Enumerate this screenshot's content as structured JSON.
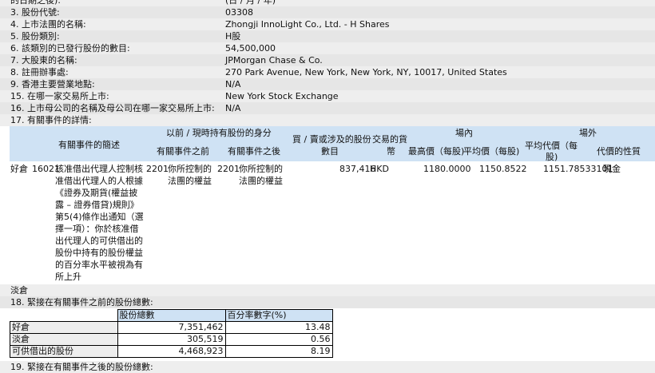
{
  "fields": [
    {
      "k": "的日期之後):",
      "v": "(日 / 月 / 年)"
    },
    {
      "k": "3. 股份代號:",
      "v": "03308"
    },
    {
      "k": "4. 上市法團的名稱:",
      "v": "Zhongji InnoLight Co., Ltd. - H Shares"
    },
    {
      "k": "5. 股份類別:",
      "v": "H股"
    },
    {
      "k": "6. 該類別的已發行股份的數目:",
      "v": "54,500,000"
    },
    {
      "k": "7. 大股東的名稱:",
      "v": "JPMorgan Chase & Co."
    },
    {
      "k": "8. 註冊辦事處:",
      "v": "270 Park Avenue, New York, New York, NY, 10017, United States"
    },
    {
      "k": "9. 香港主要營業地點:",
      "v": "N/A"
    },
    {
      "k": "15. 在哪一家交易所上市:",
      "v": "New York Stock Exchange"
    },
    {
      "k": "16. 上市母公司的名稱及母公司在哪一家交易所上市:",
      "v": "N/A"
    },
    {
      "k": "17. 有關事件的詳情:",
      "v": ""
    }
  ],
  "event_table": {
    "h_event_desc": "有關事件的簡述",
    "h_capacity": "以前 / 現時持有股份的身分",
    "h_before": "有關事件之前",
    "h_after": "有關事件之後",
    "h_shares_l1": "買 / 賣或涉及的股份",
    "h_shares_l2": "數目",
    "h_currency_l1": "交易的貨",
    "h_currency_l2": "幣",
    "h_onex": "場內",
    "h_high": "最高價（每股)",
    "h_avg": "平均價（每股)",
    "h_offex": "場外",
    "h_offavg_l1": "平均代價（每",
    "h_offavg_l2": "股)",
    "h_nature": "代價的性質",
    "row": {
      "position": "好倉",
      "code": "16021",
      "description": "核准借出代理人控制核准借出代理人的人根據《證券及期貨(權益披露 – 證券借貸)規則》第5(4)條作出通知（選擇一項）：你於核准借出代理人的可供借出的股份中持有的股份權益的百分率水平被視為有所上升",
      "before_code": "2201",
      "before": "你所控制的法團的權益",
      "after_code": "2201",
      "after": "你所控制的法團的權益",
      "shares": "837,416",
      "currency": "HKD",
      "high": "1180.0000",
      "avg": "1150.8522",
      "offavg": "1151.78533101",
      "nature": "現金"
    },
    "short_position": "淡倉"
  },
  "section18": {
    "title": "18. 緊接在有關事件之前的股份總數:",
    "col_total": "股份總數",
    "col_pct": "百分率數字(%)",
    "rows": [
      {
        "label": "好倉",
        "total": "7,351,462",
        "pct": "13.48"
      },
      {
        "label": "淡倉",
        "total": "305,519",
        "pct": "0.56"
      },
      {
        "label": "可供借出的股份",
        "total": "4,468,923",
        "pct": "8.19"
      }
    ]
  },
  "section19": {
    "title": "19. 緊接在有關事件之後的股份總數:"
  }
}
